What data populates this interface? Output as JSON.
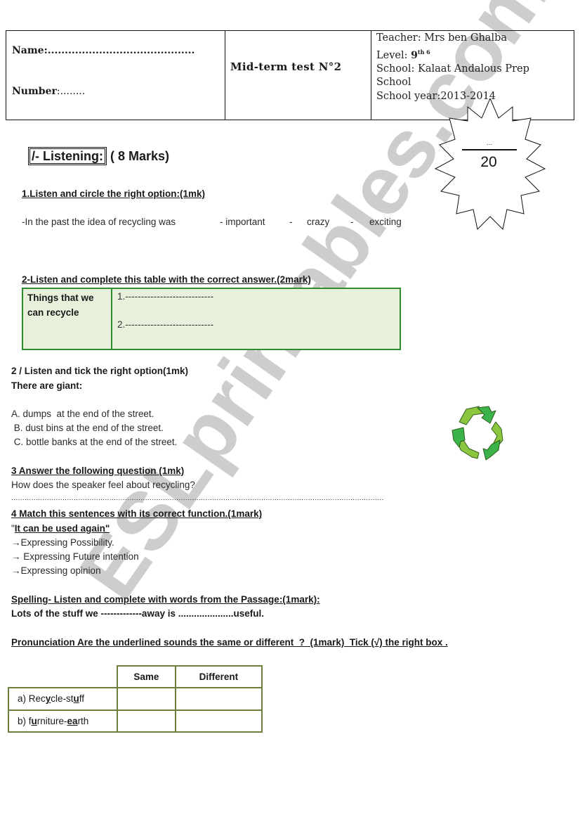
{
  "header": {
    "name_label": "Name:",
    "name_dots": "...........................................",
    "number_label": "Number",
    "number_dots": ":........",
    "test_title": "Mid-term test N°2",
    "teacher": "Teacher: Mrs ben Ghalba",
    "level_label": "Level: ",
    "level_value": "9",
    "level_sup": "th 6",
    "school": "School: Kalaat Andalous Prep",
    "school_cont": "School",
    "school_year": "School year:2013-2014"
  },
  "score": {
    "obtained": "...",
    "total": "20"
  },
  "section": {
    "boxed_label": "/- Listening:",
    "marks": " ( 8 Marks)"
  },
  "q1": {
    "title": "1.Listen and circle the right option:(1mk)",
    "stem": "-In the past the idea of recycling was",
    "options": [
      "- important",
      "-",
      "crazy",
      "-",
      "exciting"
    ]
  },
  "q2": {
    "title": "2-Listen and complete this table with  the correct answer.(2mark)",
    "table_label": "Things that we can recycle",
    "answers": [
      "1.----------------------------",
      "2.----------------------------"
    ]
  },
  "q3": {
    "title": "2 / Listen and tick the right option(1mk)",
    "stem": "There are giant:",
    "options": [
      "A. dumps  at the end of the street.",
      " B. dust bins at the end of the street.",
      " C. bottle banks at the end of the street."
    ]
  },
  "q4": {
    "title": "3 Answer the following question (1mk)",
    "question": "How does the speaker feel about recycling?",
    "answer_line": "......................................................................................................................................................................."
  },
  "q5": {
    "title": "4 Match this sentences with its correct function.(1mark)",
    "quote_open": "\"",
    "quote": "It can be used again\"",
    "options": [
      "→Expressing Possibility.",
      "→ Expressing Future intention",
      "→Expressing opinion"
    ]
  },
  "spelling": {
    "title": "Spelling- Listen and complete with words from the Passage:(1mark):",
    "sentence": "Lots of the stuff we -------------away is .....................useful."
  },
  "pronunciation": {
    "title": "Pronunciation Are the underlined sounds the same or different  ?  (1mark)  Tick (√) the right box .",
    "columns": [
      "Same",
      "Different"
    ],
    "rows": [
      {
        "parts": [
          "a) Rec",
          "y",
          "cle-st",
          "u",
          "ff"
        ]
      },
      {
        "parts": [
          "b) f",
          "u",
          "rniture-",
          "ea",
          "rth"
        ]
      }
    ]
  },
  "watermark": "ESLprintables.com"
}
